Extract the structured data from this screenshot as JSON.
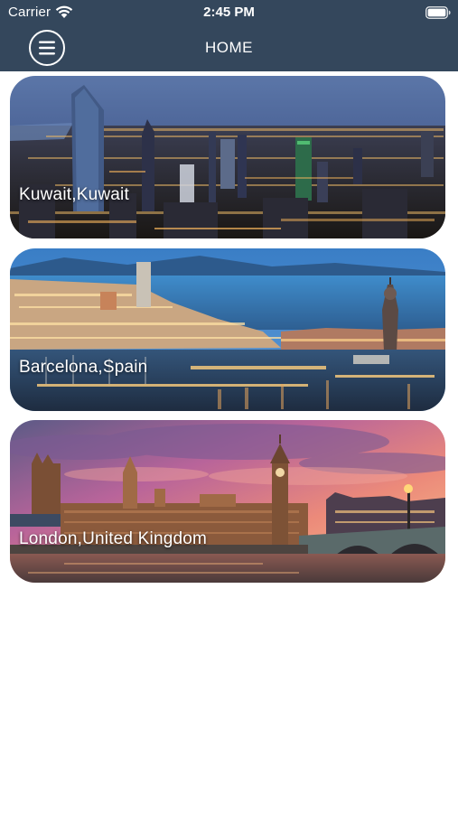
{
  "status_bar": {
    "carrier": "Carrier",
    "time": "2:45 PM",
    "icons": [
      "wifi-icon",
      "battery-icon"
    ]
  },
  "nav": {
    "title": "HOME",
    "menu_icon": "hamburger-menu-icon"
  },
  "cities": [
    {
      "label": "Kuwait,Kuwait"
    },
    {
      "label": "Barcelona,Spain"
    },
    {
      "label": "London,United Kingdom"
    }
  ],
  "colors": {
    "nav_background": "#34475c",
    "page_background": "#ffffff",
    "text_on_nav": "#ffffff"
  }
}
